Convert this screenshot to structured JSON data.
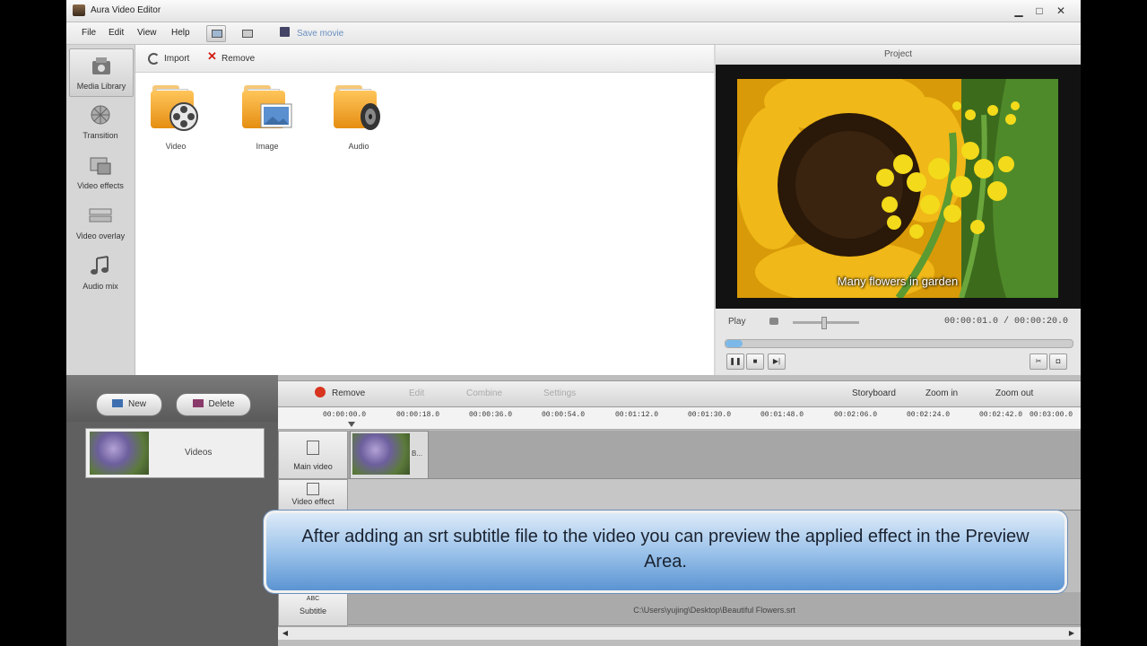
{
  "window": {
    "title": "Aura Video Editor",
    "minimize": "▁",
    "maximize": "□",
    "close": "✕"
  },
  "menu": {
    "file": "File",
    "edit": "Edit",
    "view": "View",
    "help": "Help",
    "save_movie": "Save movie"
  },
  "sidebar": {
    "items": [
      {
        "label": "Media Library",
        "icon": "media-library-icon"
      },
      {
        "label": "Transition",
        "icon": "transition-icon"
      },
      {
        "label": "Video effects",
        "icon": "video-effects-icon"
      },
      {
        "label": "Video overlay",
        "icon": "video-overlay-icon"
      },
      {
        "label": "Audio mix",
        "icon": "audio-mix-icon"
      }
    ]
  },
  "media": {
    "import_label": "Import",
    "remove_label": "Remove",
    "folders": [
      {
        "label": "Video",
        "icon": "video-folder-icon"
      },
      {
        "label": "Image",
        "icon": "image-folder-icon"
      },
      {
        "label": "Audio",
        "icon": "audio-folder-icon"
      }
    ]
  },
  "preview": {
    "header": "Project",
    "caption": "Many flowers in garden",
    "play_label": "Play",
    "time": "00:00:01.0 / 00:00:20.0",
    "progress": 0.05
  },
  "library": {
    "new_label": "New",
    "delete_label": "Delete",
    "item_label": "Videos"
  },
  "timeline": {
    "toolbar": {
      "remove": "Remove",
      "edit": "Edit",
      "combine": "Combine",
      "settings": "Settings",
      "storyboard": "Storyboard",
      "zoom_in": "Zoom in",
      "zoom_out": "Zoom out"
    },
    "ruler": [
      "00:00:00.0",
      "00:00:18.0",
      "00:00:36.0",
      "00:00:54.0",
      "00:01:12.0",
      "00:01:30.0",
      "00:01:48.0",
      "00:02:06.0",
      "00:02:24.0",
      "00:02:42.0",
      "00:03:00.0"
    ],
    "tracks": {
      "main_video": "Main video",
      "video_effect": "Video effect",
      "subtitle_icon": "ABC",
      "subtitle": "Subtitle"
    },
    "clip_label": "B...",
    "srt_path": "C:\\Users\\yujing\\Desktop\\Beautiful Flowers.srt"
  },
  "callout": {
    "text": "After adding an srt subtitle file to the video you can preview the applied effect in the Preview Area."
  }
}
